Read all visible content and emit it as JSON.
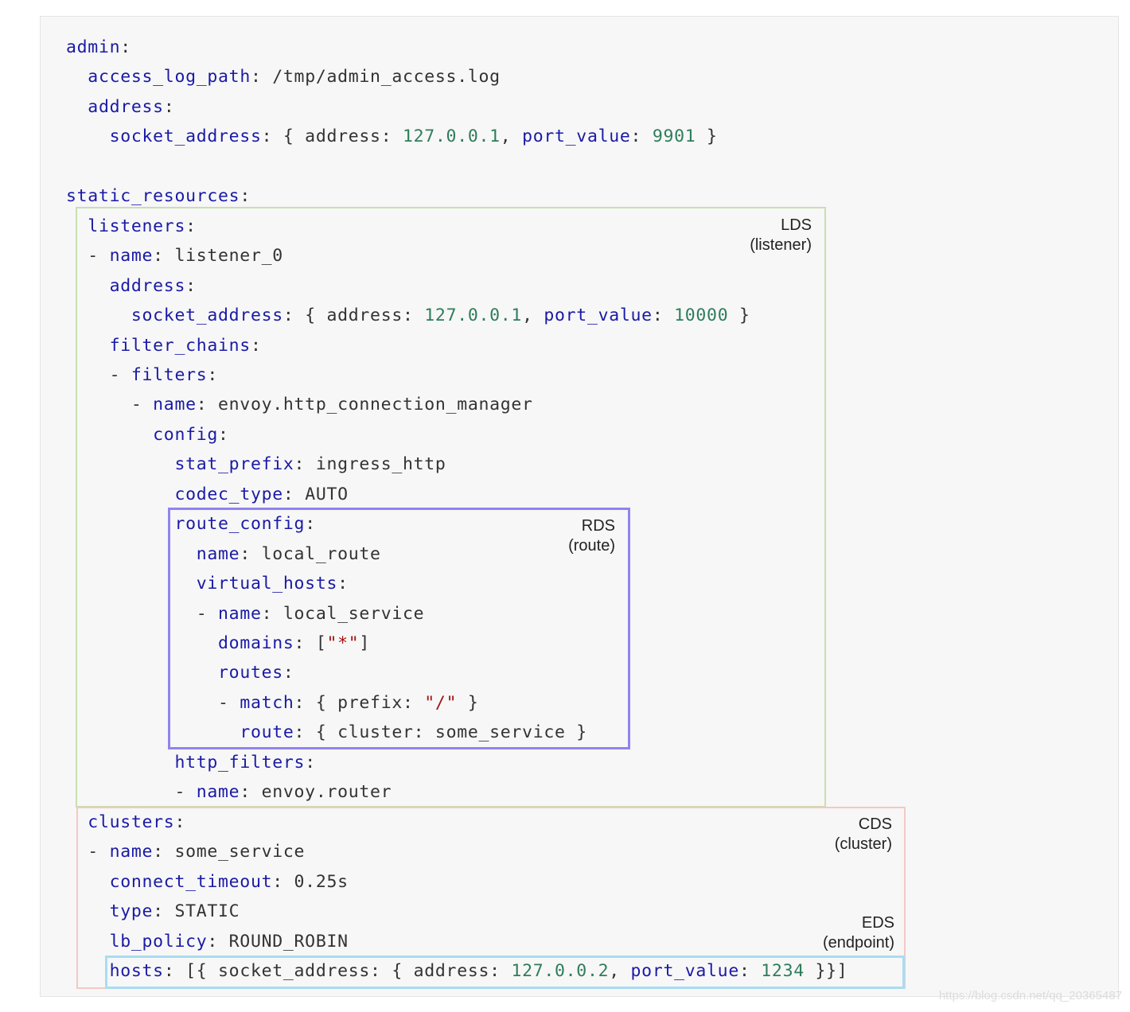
{
  "code_lines": [
    [
      [
        "k",
        "admin"
      ],
      [
        "p",
        ":"
      ]
    ],
    [
      [
        "p",
        "  "
      ],
      [
        "k",
        "access_log_path"
      ],
      [
        "p",
        ": /tmp/admin_access.log"
      ]
    ],
    [
      [
        "p",
        "  "
      ],
      [
        "k",
        "address"
      ],
      [
        "p",
        ":"
      ]
    ],
    [
      [
        "p",
        "    "
      ],
      [
        "k",
        "socket_address"
      ],
      [
        "p",
        ": { address: "
      ],
      [
        "n",
        "127.0.0.1"
      ],
      [
        "p",
        ", "
      ],
      [
        "k",
        "port_value"
      ],
      [
        "p",
        ": "
      ],
      [
        "n",
        "9901"
      ],
      [
        "p",
        " }"
      ]
    ],
    [],
    [
      [
        "k",
        "static_resources"
      ],
      [
        "p",
        ":"
      ]
    ],
    [
      [
        "p",
        "  "
      ],
      [
        "k",
        "listeners"
      ],
      [
        "p",
        ":"
      ]
    ],
    [
      [
        "p",
        "  - "
      ],
      [
        "k",
        "name"
      ],
      [
        "p",
        ": listener_0"
      ]
    ],
    [
      [
        "p",
        "    "
      ],
      [
        "k",
        "address"
      ],
      [
        "p",
        ":"
      ]
    ],
    [
      [
        "p",
        "      "
      ],
      [
        "k",
        "socket_address"
      ],
      [
        "p",
        ": { address: "
      ],
      [
        "n",
        "127.0.0.1"
      ],
      [
        "p",
        ", "
      ],
      [
        "k",
        "port_value"
      ],
      [
        "p",
        ": "
      ],
      [
        "n",
        "10000"
      ],
      [
        "p",
        " }"
      ]
    ],
    [
      [
        "p",
        "    "
      ],
      [
        "k",
        "filter_chains"
      ],
      [
        "p",
        ":"
      ]
    ],
    [
      [
        "p",
        "    - "
      ],
      [
        "k",
        "filters"
      ],
      [
        "p",
        ":"
      ]
    ],
    [
      [
        "p",
        "      - "
      ],
      [
        "k",
        "name"
      ],
      [
        "p",
        ": envoy.http_connection_manager"
      ]
    ],
    [
      [
        "p",
        "        "
      ],
      [
        "k",
        "config"
      ],
      [
        "p",
        ":"
      ]
    ],
    [
      [
        "p",
        "          "
      ],
      [
        "k",
        "stat_prefix"
      ],
      [
        "p",
        ": ingress_http"
      ]
    ],
    [
      [
        "p",
        "          "
      ],
      [
        "k",
        "codec_type"
      ],
      [
        "p",
        ": AUTO"
      ]
    ],
    [
      [
        "p",
        "          "
      ],
      [
        "k",
        "route_config"
      ],
      [
        "p",
        ":"
      ]
    ],
    [
      [
        "p",
        "            "
      ],
      [
        "k",
        "name"
      ],
      [
        "p",
        ": local_route"
      ]
    ],
    [
      [
        "p",
        "            "
      ],
      [
        "k",
        "virtual_hosts"
      ],
      [
        "p",
        ":"
      ]
    ],
    [
      [
        "p",
        "            - "
      ],
      [
        "k",
        "name"
      ],
      [
        "p",
        ": local_service"
      ]
    ],
    [
      [
        "p",
        "              "
      ],
      [
        "k",
        "domains"
      ],
      [
        "p",
        ": ["
      ],
      [
        "s",
        "\"*\""
      ],
      [
        "p",
        "]"
      ]
    ],
    [
      [
        "p",
        "              "
      ],
      [
        "k",
        "routes"
      ],
      [
        "p",
        ":"
      ]
    ],
    [
      [
        "p",
        "              - "
      ],
      [
        "k",
        "match"
      ],
      [
        "p",
        ": { prefix: "
      ],
      [
        "s",
        "\"/\""
      ],
      [
        "p",
        " }"
      ]
    ],
    [
      [
        "p",
        "                "
      ],
      [
        "k",
        "route"
      ],
      [
        "p",
        ": { cluster: some_service }"
      ]
    ],
    [
      [
        "p",
        "          "
      ],
      [
        "k",
        "http_filters"
      ],
      [
        "p",
        ":"
      ]
    ],
    [
      [
        "p",
        "          - "
      ],
      [
        "k",
        "name"
      ],
      [
        "p",
        ": envoy.router"
      ]
    ],
    [
      [
        "p",
        "  "
      ],
      [
        "k",
        "clusters"
      ],
      [
        "p",
        ":"
      ]
    ],
    [
      [
        "p",
        "  - "
      ],
      [
        "k",
        "name"
      ],
      [
        "p",
        ": some_service"
      ]
    ],
    [
      [
        "p",
        "    "
      ],
      [
        "k",
        "connect_timeout"
      ],
      [
        "p",
        ": 0.25s"
      ]
    ],
    [
      [
        "p",
        "    "
      ],
      [
        "k",
        "type"
      ],
      [
        "p",
        ": STATIC"
      ]
    ],
    [
      [
        "p",
        "    "
      ],
      [
        "k",
        "lb_policy"
      ],
      [
        "p",
        ": ROUND_ROBIN"
      ]
    ],
    [
      [
        "p",
        "    "
      ],
      [
        "k",
        "hosts"
      ],
      [
        "p",
        ": [{ socket_address: { address: "
      ],
      [
        "n",
        "127.0.0.2"
      ],
      [
        "p",
        ", "
      ],
      [
        "k",
        "port_value"
      ],
      [
        "p",
        ": "
      ],
      [
        "n",
        "1234"
      ],
      [
        "p",
        " }}]"
      ]
    ]
  ],
  "annotations": {
    "lds": {
      "title": "LDS",
      "subtitle": "(listener)"
    },
    "rds": {
      "title": "RDS",
      "subtitle": "(route)"
    },
    "cds": {
      "title": "CDS",
      "subtitle": "(cluster)"
    },
    "eds": {
      "title": "EDS",
      "subtitle": "(endpoint)"
    }
  },
  "watermark": "https://blog.csdn.net/qq_20365487",
  "colors": {
    "key": "#1a1aa6",
    "number": "#2e7d5b",
    "string": "#a31515",
    "lds_border": "#c9dfb0",
    "rds_border": "#8f84f0",
    "cds_border": "#f3c8c4",
    "eds_border": "#a9dcf2"
  }
}
